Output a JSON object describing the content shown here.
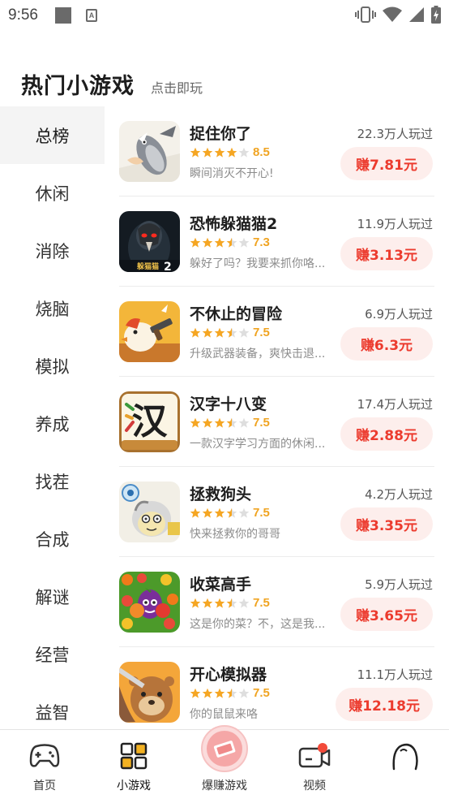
{
  "status_bar": {
    "time": "9:56"
  },
  "header": {
    "title": "热门小游戏",
    "subtitle": "点击即玩"
  },
  "sidebar": {
    "items": [
      {
        "label": "总榜",
        "active": true
      },
      {
        "label": "休闲",
        "active": false
      },
      {
        "label": "消除",
        "active": false
      },
      {
        "label": "烧脑",
        "active": false
      },
      {
        "label": "模拟",
        "active": false
      },
      {
        "label": "养成",
        "active": false
      },
      {
        "label": "找茬",
        "active": false
      },
      {
        "label": "合成",
        "active": false
      },
      {
        "label": "解谜",
        "active": false
      },
      {
        "label": "经营",
        "active": false
      },
      {
        "label": "益智",
        "active": false
      }
    ]
  },
  "games": [
    {
      "name": "捉住你了",
      "rating": 4,
      "score": "8.5",
      "description": "瞬间消灭不开心!",
      "plays": "22.3万人玩过",
      "reward": "赚7.81元"
    },
    {
      "name": "恐怖躲猫猫2",
      "rating": 3.5,
      "score": "7.3",
      "description": "躲好了吗？我要来抓你咯...",
      "plays": "11.9万人玩过",
      "reward": "赚3.13元"
    },
    {
      "name": "不休止的冒险",
      "rating": 3.5,
      "score": "7.5",
      "description": "升级武器装备，爽快击退...",
      "plays": "6.9万人玩过",
      "reward": "赚6.3元"
    },
    {
      "name": "汉字十八变",
      "rating": 3.5,
      "score": "7.5",
      "description": "一款汉字学习方面的休闲...",
      "plays": "17.4万人玩过",
      "reward": "赚2.88元"
    },
    {
      "name": "拯救狗头",
      "rating": 3.5,
      "score": "7.5",
      "description": "快来拯救你的哥哥",
      "plays": "4.2万人玩过",
      "reward": "赚3.35元"
    },
    {
      "name": "收菜高手",
      "rating": 3.5,
      "score": "7.5",
      "description": "这是你的菜？不，这是我...",
      "plays": "5.9万人玩过",
      "reward": "赚3.65元"
    },
    {
      "name": "开心模拟器",
      "rating": 3.5,
      "score": "7.5",
      "description": "你的鼠鼠来咯",
      "plays": "11.1万人玩过",
      "reward": "赚12.18元"
    }
  ],
  "thumb_texts": {
    "hide_seek": "躲猫猫",
    "hide_seek_num": "2",
    "hanzi": "汉"
  },
  "bottom_nav": {
    "items": [
      {
        "label": "首页",
        "icon": "gamepad-icon"
      },
      {
        "label": "小游戏",
        "icon": "grid-icon"
      },
      {
        "label": "爆赚游戏",
        "icon": "money-icon"
      },
      {
        "label": "视频",
        "icon": "video-camera-icon"
      },
      {
        "label": "",
        "icon": "profile-icon"
      }
    ]
  },
  "colors": {
    "accent_red": "#ec3b2e",
    "reward_bg": "#fdeeec",
    "star": "#f5a623",
    "star_empty": "#dedede",
    "sidebar_active_bg": "#f4f4f4"
  }
}
